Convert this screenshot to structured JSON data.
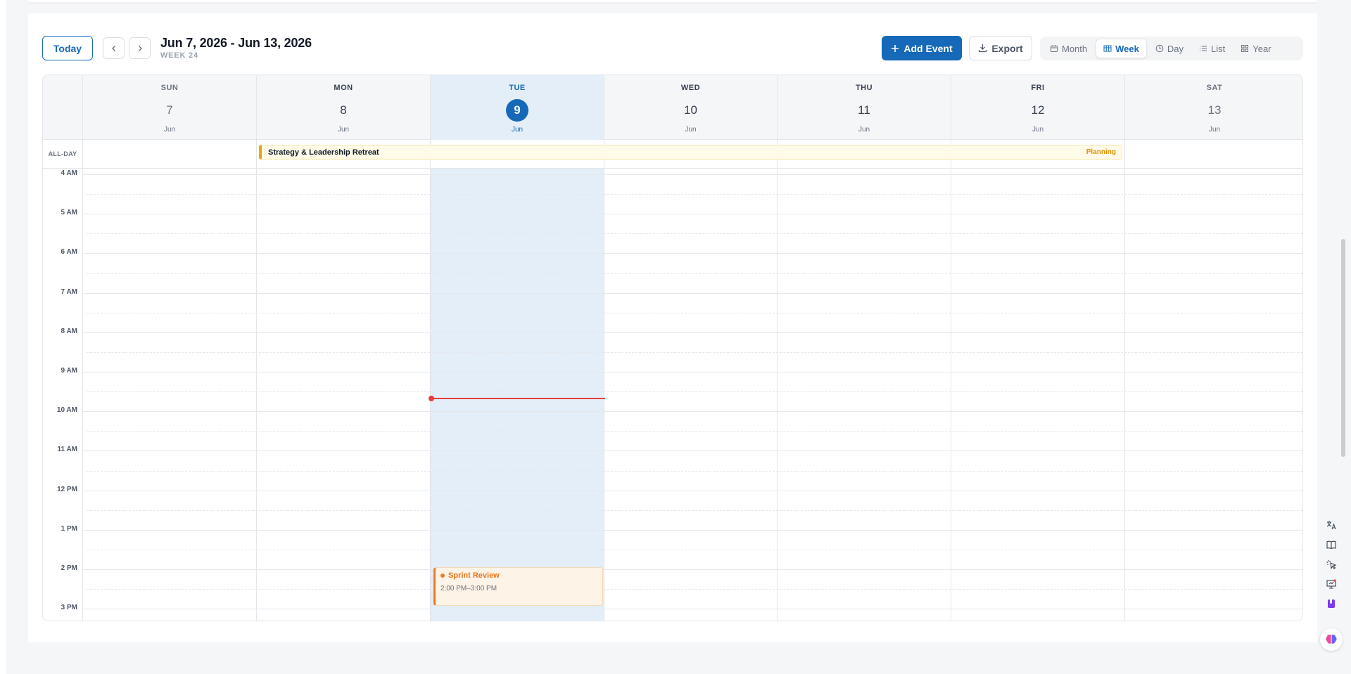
{
  "toolbar": {
    "today_label": "Today",
    "range_title": "Jun 7, 2026 - Jun 13, 2026",
    "week_label": "WEEK 24",
    "add_event_label": "Add Event",
    "export_label": "Export",
    "views": [
      {
        "label": "Month",
        "icon": "calendar-icon",
        "active": false
      },
      {
        "label": "Week",
        "icon": "grid-icon",
        "active": true
      },
      {
        "label": "Day",
        "icon": "clock-icon",
        "active": false
      },
      {
        "label": "List",
        "icon": "list-icon",
        "active": false
      },
      {
        "label": "Year",
        "icon": "year-grid-icon",
        "active": false
      }
    ]
  },
  "days": [
    {
      "name": "SUN",
      "num": "7",
      "month": "Jun"
    },
    {
      "name": "MON",
      "num": "8",
      "month": "Jun"
    },
    {
      "name": "TUE",
      "num": "9",
      "month": "Jun"
    },
    {
      "name": "WED",
      "num": "10",
      "month": "Jun"
    },
    {
      "name": "THU",
      "num": "11",
      "month": "Jun"
    },
    {
      "name": "FRI",
      "num": "12",
      "month": "Jun"
    },
    {
      "name": "SAT",
      "num": "13",
      "month": "Jun"
    }
  ],
  "allday": {
    "label": "ALL-DAY",
    "event": {
      "title": "Strategy & Leadership Retreat",
      "tag": "Planning"
    }
  },
  "hours": [
    "4 AM",
    "5 AM",
    "6 AM",
    "7 AM",
    "8 AM",
    "9 AM",
    "10 AM",
    "11 AM",
    "12 PM",
    "1 PM",
    "2 PM",
    "3 PM"
  ],
  "event": {
    "title": "Sprint Review",
    "time": "2:00 PM–3:00 PM"
  },
  "colors": {
    "primary": "#1669b8",
    "today_bg": "#e4eef8",
    "now_line": "#e53e3e",
    "allday_accent": "#f1a20d",
    "event_accent": "#ee7b22"
  },
  "side_tools": [
    "translate-icon",
    "book-icon",
    "cursor-click-icon",
    "presentation-icon",
    "bookmark-icon"
  ],
  "ai_tool": "brain-icon"
}
